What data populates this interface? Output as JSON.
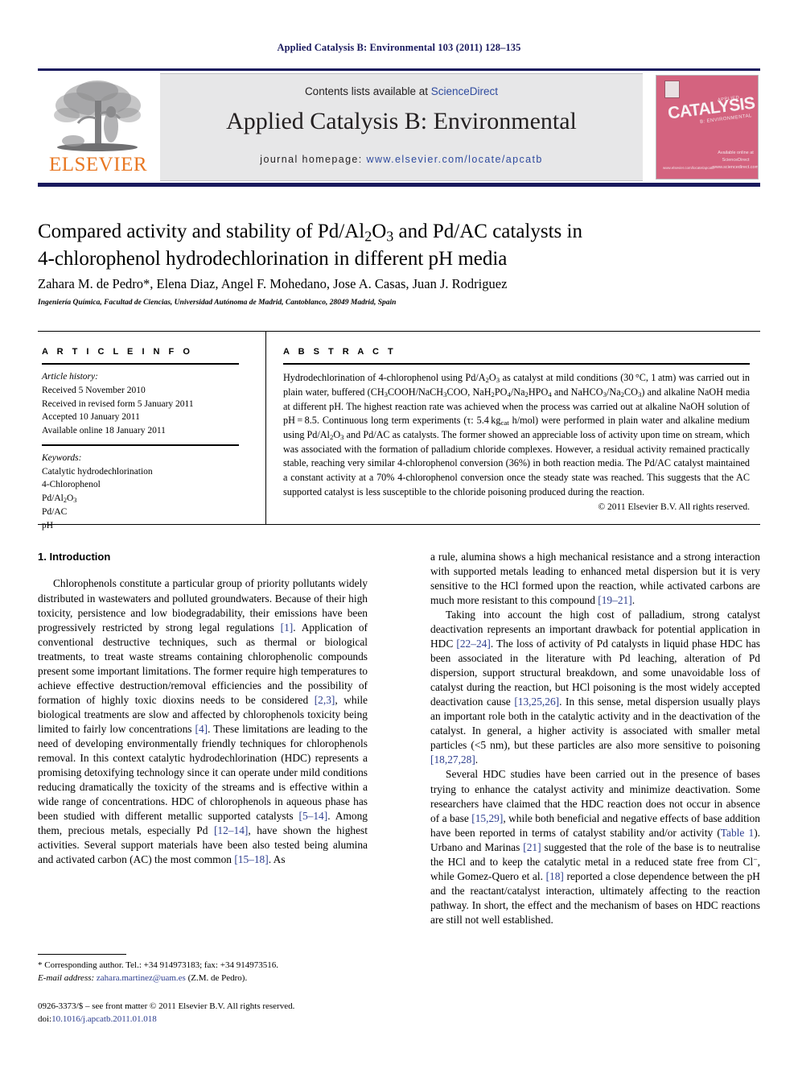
{
  "running_head": "Applied Catalysis B: Environmental 103 (2011) 128–135",
  "masthead": {
    "contents_prefix": "Contents lists available at ",
    "sciencedirect": "ScienceDirect",
    "journal_title": "Applied Catalysis B: Environmental",
    "homepage_label": "journal homepage: ",
    "homepage_url": "www.elsevier.com/locate/apcatb",
    "publisher_wordmark": "ELSEVIER",
    "publisher_accent_color": "#E87722",
    "band_color": "#e7e7e8",
    "rule_color": "#1a1a5e"
  },
  "cover": {
    "applied": "APPLIED",
    "main": "CATALYSIS",
    "sub": "B: ENVIRONMENTAL",
    "logo_block": "Available online at\nScienceDirect\nwww.sciencedirect.com",
    "footer": "www.elsevier.com/locate/apcatb",
    "color": "#d4637f"
  },
  "article": {
    "title_line1": "Compared activity and stability of Pd/Al",
    "title_sub1": "2",
    "title_line1b": "O",
    "title_sub2": "3",
    "title_line1c": " and Pd/AC catalysts in",
    "title_line2": "4-chlorophenol hydrodechlorination in different pH media",
    "authors": "Zahara M. de Pedro*, Elena Diaz, Angel F. Mohedano, Jose A. Casas, Juan J. Rodriguez",
    "affiliation": "Ingeniería Química, Facultad de Ciencias, Universidad Autónoma de Madrid, Cantoblanco, 28049 Madrid, Spain"
  },
  "article_info": {
    "heading": "A R T I C L E  I N F O",
    "history_label": "Article history:",
    "history": [
      "Received 5 November 2010",
      "Received in revised form 5 January 2011",
      "Accepted 10 January 2011",
      "Available online 18 January 2011"
    ],
    "keywords_label": "Keywords:",
    "keywords": [
      "Catalytic hydrodechlorination",
      "4-Chlorophenol",
      "Pd/Al2O3",
      "Pd/AC",
      "pH"
    ]
  },
  "abstract": {
    "heading": "A B S T R A C T",
    "text": "Hydrodechlorination of 4-chlorophenol using Pd/A2O3 as catalyst at mild conditions (30 °C, 1 atm) was carried out in plain water, buffered (CH3COOH/NaCH3COO, NaH2PO4/Na2HPO4 and NaHCO3/Na2CO3) and alkaline NaOH media at different pH. The highest reaction rate was achieved when the process was carried out at alkaline NaOH solution of pH = 8.5. Continuous long term experiments (τ: 5.4 kgcat h/mol) were performed in plain water and alkaline medium using Pd/Al2O3 and Pd/AC as catalysts. The former showed an appreciable loss of activity upon time on stream, which was associated with the formation of palladium chloride complexes. However, a residual activity remained practically stable, reaching very similar 4-chlorophenol conversion (36%) in both reaction media. The Pd/AC catalyst maintained a constant activity at a 70% 4-chlorophenol conversion once the steady state was reached. This suggests that the AC supported catalyst is less susceptible to the chloride poisoning produced during the reaction.",
    "copyright": "© 2011 Elsevier B.V. All rights reserved."
  },
  "introduction": {
    "section_title": "1.  Introduction",
    "left_p1": "Chlorophenols constitute a particular group of priority pollutants widely distributed in wastewaters and polluted groundwaters. Because of their high toxicity, persistence and low biodegradability, their emissions have been progressively restricted by strong legal regulations [1]. Application of conventional destructive techniques, such as thermal or biological treatments, to treat waste streams containing chlorophenolic compounds present some important limitations. The former require high temperatures to achieve effective destruction/removal efficiencies and the possibility of formation of highly toxic dioxins needs to be considered [2,3], while biological treatments are slow and affected by chlorophenols toxicity being limited to fairly low concentrations [4]. These limitations are leading to the need of developing environmentally friendly techniques for chlorophenols removal. In this context catalytic hydrodechlorination (HDC) represents a promising detoxifying technology since it can operate under mild conditions reducing dramatically the toxicity of the streams and is effective within a wide range of concentrations. HDC of chlorophenols in aqueous phase has been studied with different metallic supported catalysts [5–14]. Among them, precious metals, especially Pd [12–14], have shown the highest activities. Several support materials have been also tested being alumina and activated carbon (AC) the most common [15–18]. As",
    "right_p1": "a rule, alumina shows a high mechanical resistance and a strong interaction with supported metals leading to enhanced metal dispersion but it is very sensitive to the HCl formed upon the reaction, while activated carbons are much more resistant to this compound [19–21].",
    "right_p2": "Taking into account the high cost of palladium, strong catalyst deactivation represents an important drawback for potential application in HDC [22–24]. The loss of activity of Pd catalysts in liquid phase HDC has been associated in the literature with Pd leaching, alteration of Pd dispersion, support structural breakdown, and some unavoidable loss of catalyst during the reaction, but HCl poisoning is the most widely accepted deactivation cause [13,25,26]. In this sense, metal dispersion usually plays an important role both in the catalytic activity and in the deactivation of the catalyst. In general, a higher activity is associated with smaller metal particles (<5 nm), but these particles are also more sensitive to poisoning [18,27,28].",
    "right_p3": "Several HDC studies have been carried out in the presence of bases trying to enhance the catalyst activity and minimize deactivation. Some researchers have claimed that the HDC reaction does not occur in absence of a base [15,29], while both beneficial and negative effects of base addition have been reported in terms of catalyst stability and/or activity (Table 1). Urbano and Marinas [21] suggested that the role of the base is to neutralise the HCl and to keep the catalytic metal in a reduced state free from Cl−, while Gomez-Quero et al. [18] reported a close dependence between the pH and the reactant/catalyst interaction, ultimately affecting to the reaction pathway. In short, the effect and the mechanism of bases on HDC reactions are still not well established."
  },
  "footnote": {
    "corresponding": "* Corresponding author. Tel.: +34 914973183; fax: +34 914973516.",
    "email_label": "E-mail address: ",
    "email": "zahara.martinez@uam.es",
    "email_suffix": " (Z.M. de Pedro)."
  },
  "imprint": {
    "line1": "0926-3373/$ – see front matter © 2011 Elsevier B.V. All rights reserved.",
    "doi_label": "doi:",
    "doi": "10.1016/j.apcatb.2011.01.018"
  }
}
